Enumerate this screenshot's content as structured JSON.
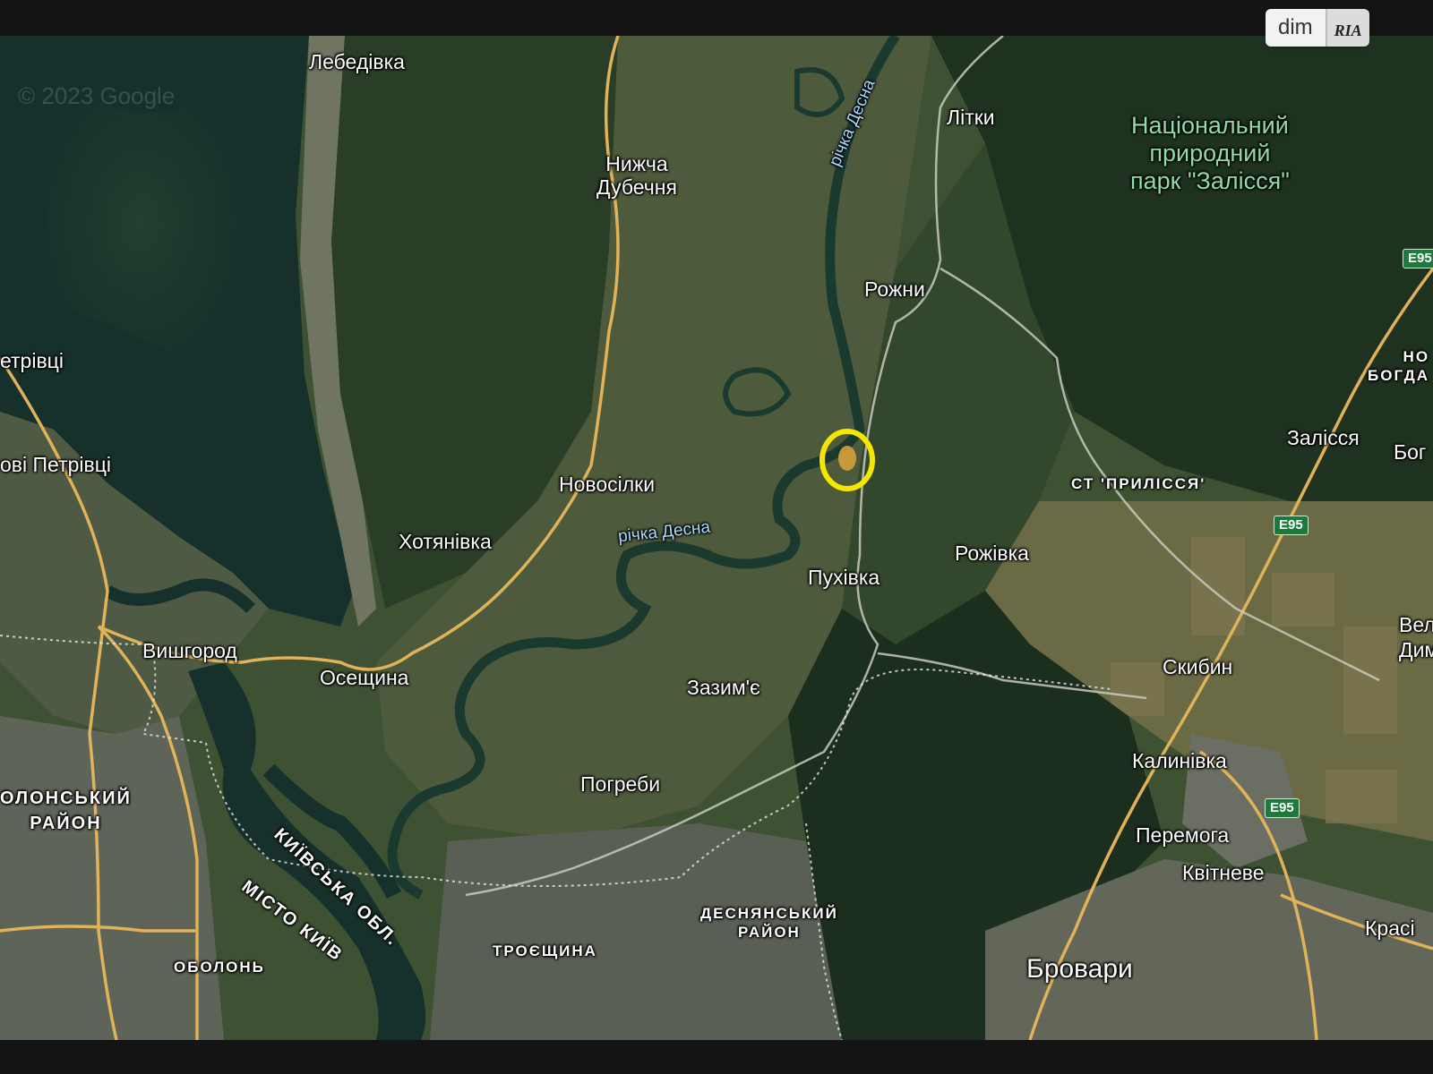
{
  "logo": {
    "part1": "dim",
    "part2": "RIA"
  },
  "map": {
    "watermark": "© 2023 Google",
    "labels": [
      {
        "key": "lebedivka",
        "text": "Лебедівка"
      },
      {
        "key": "litky",
        "text": "Літки"
      },
      {
        "key": "nyzhcha",
        "text": "Нижча\nДубечня"
      },
      {
        "key": "river_desna_north",
        "text": "річка Десна"
      },
      {
        "key": "park",
        "text": "Національний\nприродний\nпарк \"Залісся\""
      },
      {
        "key": "rozhny",
        "text": "Рожни"
      },
      {
        "key": "petrivtsi",
        "text": "етрівці"
      },
      {
        "key": "novi_petrivtsi",
        "text": "ові Петрівці"
      },
      {
        "key": "novosilky",
        "text": "Новосілки"
      },
      {
        "key": "khotianivka",
        "text": "Хотянівка"
      },
      {
        "key": "river_desna_south",
        "text": "річка Десна"
      },
      {
        "key": "pukhivka",
        "text": "Пухівка"
      },
      {
        "key": "rozhivka",
        "text": "Рожівка"
      },
      {
        "key": "st_prylissia",
        "text": "СТ 'ПРИЛІССЯ'"
      },
      {
        "key": "zalissia",
        "text": "Залісся"
      },
      {
        "key": "bogdanivka",
        "text": "НО\nБОГДА"
      },
      {
        "key": "bo",
        "text": "Бог"
      },
      {
        "key": "vyshhorod",
        "text": "Вишгород"
      },
      {
        "key": "osesh",
        "text": "Осещина"
      },
      {
        "key": "zazymie",
        "text": "Зазим'є"
      },
      {
        "key": "skybyn",
        "text": "Скибин"
      },
      {
        "key": "veli",
        "text": "Вел\nДим"
      },
      {
        "key": "kalynivka",
        "text": "Калинівка"
      },
      {
        "key": "obolonskyi",
        "text": "ОЛОНСЬКИЙ\nРАЙОН"
      },
      {
        "key": "kyivska",
        "text": "КИЇВСЬКА ОБЛ."
      },
      {
        "key": "pohreby",
        "text": "Погреби"
      },
      {
        "key": "peremoha",
        "text": "Перемога"
      },
      {
        "key": "misto_kyiv",
        "text": "МІСТО КИЇВ"
      },
      {
        "key": "kvitneve",
        "text": "Квітневе"
      },
      {
        "key": "desnianskyi",
        "text": "ДЕСНЯНСЬКИЙ\nРАЙОН"
      },
      {
        "key": "krasy",
        "text": "Красі"
      },
      {
        "key": "obolon",
        "text": "ОБОЛОНЬ"
      },
      {
        "key": "troieshchyna",
        "text": "ТРОЄЩИНА"
      },
      {
        "key": "brovary",
        "text": "Бровари"
      }
    ],
    "road_shields": [
      "E95",
      "E95",
      "E95"
    ],
    "colors": {
      "water": "#16312b",
      "forest": "#233722",
      "fields": "#4d5a3c",
      "urban": "#6b6e63",
      "road": "#e0b25a",
      "marker": "#f5e600"
    }
  }
}
